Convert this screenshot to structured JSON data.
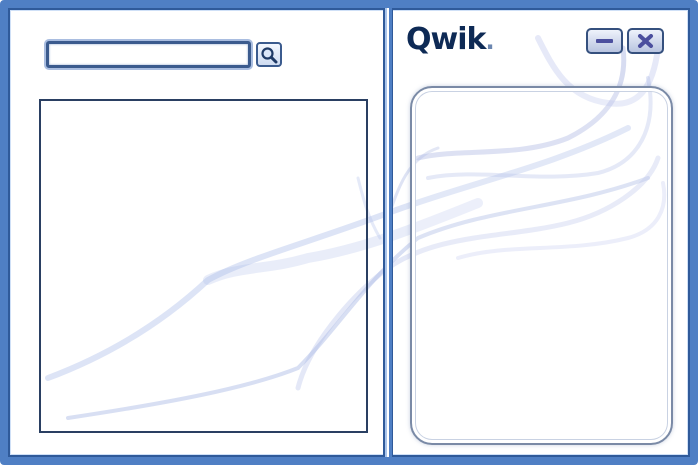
{
  "app": {
    "logo_text": "Qwik",
    "logo_dot": "."
  },
  "search": {
    "value": "",
    "placeholder": ""
  },
  "icons": {
    "search": "magnifier-icon",
    "minimize": "minimize-icon",
    "close": "close-x-icon"
  },
  "colors": {
    "frame": "#4f7fc4",
    "frame_dark": "#2f5a9a",
    "button_icon": "#4b4f9e",
    "logo": "#1d3a66"
  }
}
